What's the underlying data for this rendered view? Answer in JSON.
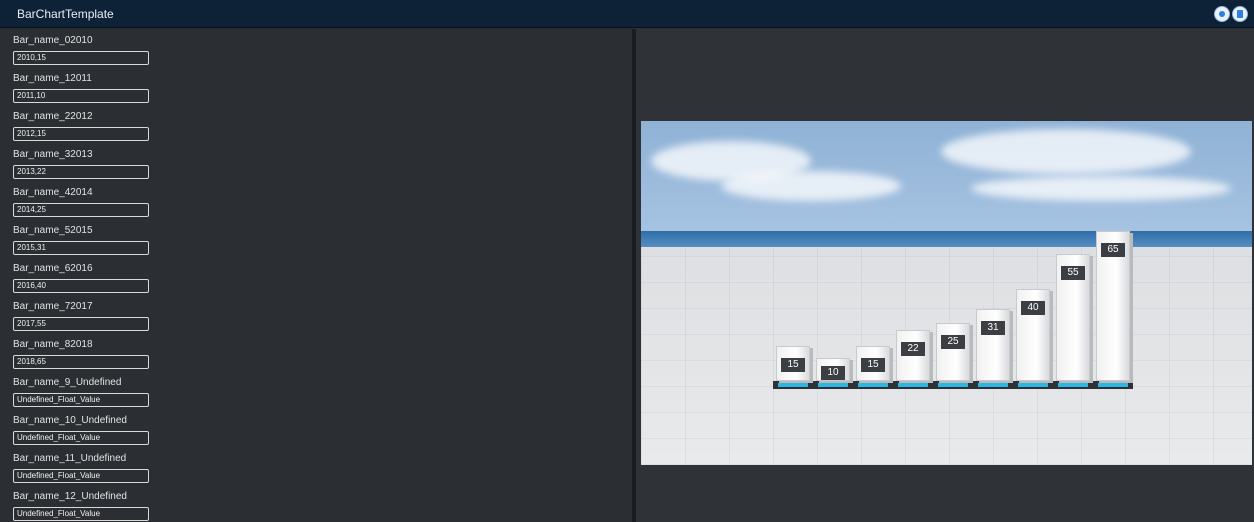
{
  "window": {
    "title": "BarChartTemplate",
    "icons": [
      "settings-icon",
      "delete-icon"
    ]
  },
  "fields": [
    {
      "label": "Bar_name_02010",
      "value": "2010,15"
    },
    {
      "label": "Bar_name_12011",
      "value": "2011,10"
    },
    {
      "label": "Bar_name_22012",
      "value": "2012,15"
    },
    {
      "label": "Bar_name_32013",
      "value": "2013,22"
    },
    {
      "label": "Bar_name_42014",
      "value": "2014,25"
    },
    {
      "label": "Bar_name_52015",
      "value": "2015,31"
    },
    {
      "label": "Bar_name_62016",
      "value": "2016,40"
    },
    {
      "label": "Bar_name_72017",
      "value": "2017,55"
    },
    {
      "label": "Bar_name_82018",
      "value": "2018,65"
    },
    {
      "label": "Bar_name_9_Undefined",
      "value": "Undefined_Float_Value"
    },
    {
      "label": "Bar_name_10_Undefined",
      "value": "Undefined_Float_Value"
    },
    {
      "label": "Bar_name_11_Undefined",
      "value": "Undefined_Float_Value"
    },
    {
      "label": "Bar_name_12_Undefined",
      "value": "Undefined_Float_Value"
    }
  ],
  "chart_data": {
    "type": "bar",
    "categories": [
      "2010",
      "2011",
      "2012",
      "2013",
      "2014",
      "2015",
      "2016",
      "2017",
      "2018"
    ],
    "values": [
      15,
      10,
      15,
      22,
      25,
      31,
      40,
      55,
      65
    ],
    "ylim": [
      0,
      65
    ],
    "colors": {
      "bar": "#f4f4f4",
      "label": "#3b3f44",
      "base_tag": "#2bb7e6"
    }
  }
}
